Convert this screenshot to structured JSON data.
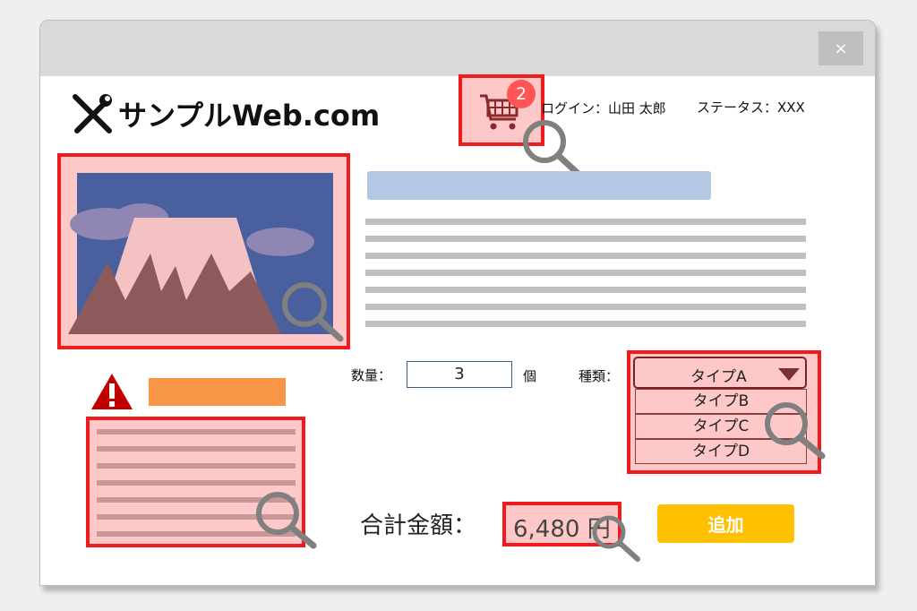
{
  "window": {
    "close_label": "×"
  },
  "header": {
    "logo_text": "サンプルWeb.com",
    "cart_count": "2",
    "login_text": "ログイン：山田 太郎",
    "status_text": "ステータス：XXX"
  },
  "form": {
    "quantity_label": "数量：",
    "quantity_value": "3",
    "quantity_unit": "個",
    "type_label": "種類：",
    "type_selected": "タイプA",
    "type_options": [
      "タイプB",
      "タイプC",
      "タイプD"
    ]
  },
  "total": {
    "label": "合計金額：",
    "value": "6,480 円"
  },
  "actions": {
    "add_label": "追加"
  },
  "colors": {
    "highlight_fill": "#ffc8c8",
    "highlight_border": "#ee1c1c",
    "title_placeholder": "#b4c8e4",
    "warning_bar": "#f79646",
    "add_button": "#ffc000",
    "cart_badge": "#ff5555",
    "image_sky": "#4a5f9e"
  },
  "icons": [
    "tools-icon",
    "cart-icon",
    "magnifier-icon",
    "warning-icon",
    "dropdown-arrow-icon",
    "close-icon"
  ]
}
